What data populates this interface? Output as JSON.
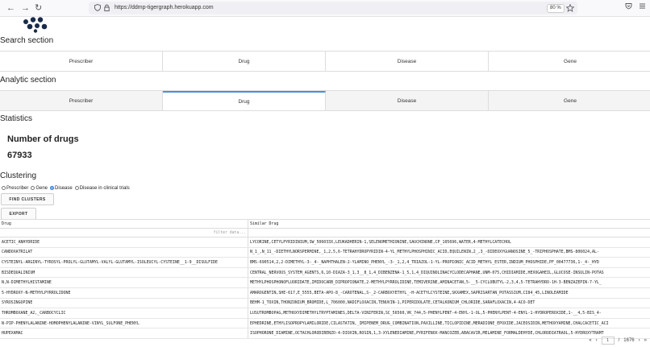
{
  "browser": {
    "url": "https://ddmp-tigergraph.herokuapp.com",
    "zoom": "80 %",
    "back_icon": "←",
    "forward_icon": "→",
    "reload_icon": "↻"
  },
  "search_section": {
    "title": "Search section",
    "tabs": [
      "Prescriber",
      "Drug",
      "Disease",
      "Gene"
    ]
  },
  "analytic_section": {
    "title": "Analytic section",
    "tabs": [
      "Prescriber",
      "Drug",
      "Disease",
      "Gene"
    ],
    "active_tab": "Drug"
  },
  "statistics": {
    "title": "Statistics",
    "label": "Number of drugs",
    "value": "67933"
  },
  "clustering": {
    "title": "Clustering",
    "options": [
      "Prescriber",
      "Gene",
      "Disease",
      "Disease in clinical trials"
    ],
    "selected": "Disease",
    "find_button": "FIND CLUSTERS",
    "export_button": "EXPORT"
  },
  "table": {
    "columns": [
      "Drug",
      "Similar Drug"
    ],
    "filter_placeholder": "filter data...",
    "rows": [
      [
        "ACETIC_ANHYDRIDE",
        "LYCORINE,CETYLPYRIDINIUM,SW_506033X,LEUKADHERIN-1,SELENOMETHIONINE,SAUCHINONE,CP_105696,WATER,4-METHYLCATECHOL"
      ],
      [
        "CANDOXATRILAT",
        "N_1_,N_11_-DIETHYLNORSPERMINE,_1,2,5,6-TETRAHYDROPYRIDIN-4-YL_METHYLPHOSPHINIC_ACID,EQUILENIN,2_,3_-DIDEOXYGUANOSINE_5_-TRIPHOSPHATE,BMS-806024,AL-"
      ],
      [
        "CYSTEINYL-ARGINYL-TYROSYL-PROLYL-GLUTAMYL-VALYL-GLUTAMYL-ISOLEUCYL-CYSTEINE__1-9__DISULFIDE",
        "BMS-690514,2,2-DIMETHYL-3-_4-_NAPHTHALEN-2-YLAMINO_PHENYL_-3-_1,2,4_TRIAZOL-1-YL-PROPIONIC_ACID_METHYL_ESTER,INDIUM_PHOSPHIDE,PF_00477736,1-_4-_HYD"
      ],
      [
        "BISDEQUALINIUM",
        "CENTRAL_NERVOUS_SYSTEM_AGENTS,6,10-DIAZA-3_1,3__8_1,4_DIBENZENA-1_5,1,4_DIQUINOLINACYCLODECAPHANE,UNM-075,CHIDIAMIDE,HEXOGAHEIL,GLUCOSE-INSULIN-POTAS"
      ],
      [
        "N,N-DIMETHYLHISTAMINE",
        "METHYLPHOSPHONOFLUORIDATE,IMIDOCARB_DIPROPIONATE,2-METHYLPYRROLIDINE,TEMIVERINE,AMINACETAN,5-__5-CYCLOBUTYL-2,3,4,5-TETRAHYDRO-1H-3-BENZAZEPIN-7-YL_"
      ],
      [
        "5-HYDROXY-N-METHYLPYRROLIDONE",
        "AMAROGENTIN,SHE-617,E_5555,BETA-APO-8_-CAROTENAL,S-_2-CARBOXYETHYL_-H-ACETYLCYSTEINE,SKXAMEX,SAPRISARTAN_POTASSIUM,CI84_45,LINOLEAMIDE"
      ],
      [
        "SYROSINGOPINE",
        "BEHM-1_TOXIN,THONZONIUM_BROMIDE,L_706000,NADIFLOXACIN,TENUVIN-1,PIPERIDOLATE,CETALKONIUM_CHLORIDE,SARAFLOXACIN,4-ACO-DET"
      ],
      [
        "THROMBOXANE_A2,_CARBOCYCLIC",
        "LUSUTROMBOPAG,METHOXYDIMETHYLTRYPTAMINES,DELTA-VINIFERIN,SC_56560,VK_744,5-PHENYLPENT-4-ENYL-1-OL,5-PHENYLPENT-4-ENYL-1-HYDROPEROXIDE,1-__4,5-BIS_4-"
      ],
      [
        "N-PIP-PHENYLALANINE-HOMOPHENYLALANINE-VINYL_SULFONE_PHENYL",
        "EPHEDRINE,ETHYLISOPROPYLAMILORIDE,CILASTATIN,_IMIPENEM_DRUG_COMBINATION,PAXILLINE,TICLOPIDINE,MERADIONE_EPOXIDE,JACEOSIDIN,METHOXYAMINE,CHALCACETIC_ACI"
      ],
      [
        "HUPEXAMAC",
        "ISOPHORONE_DIAMINE,OCTACHLORODIBENZO-4-DIOXIN,ROSIN,1,3-XYLENEDIAMINE,PYRIFENOX-MANCOZEB,ABACAVIR,MELAMINE_FORMALDEHYDE,CHLORODIATRAOL,5-HYDROXYTRAMT"
      ]
    ]
  },
  "pager": {
    "current": "1",
    "total": "1676",
    "separator": "/"
  }
}
